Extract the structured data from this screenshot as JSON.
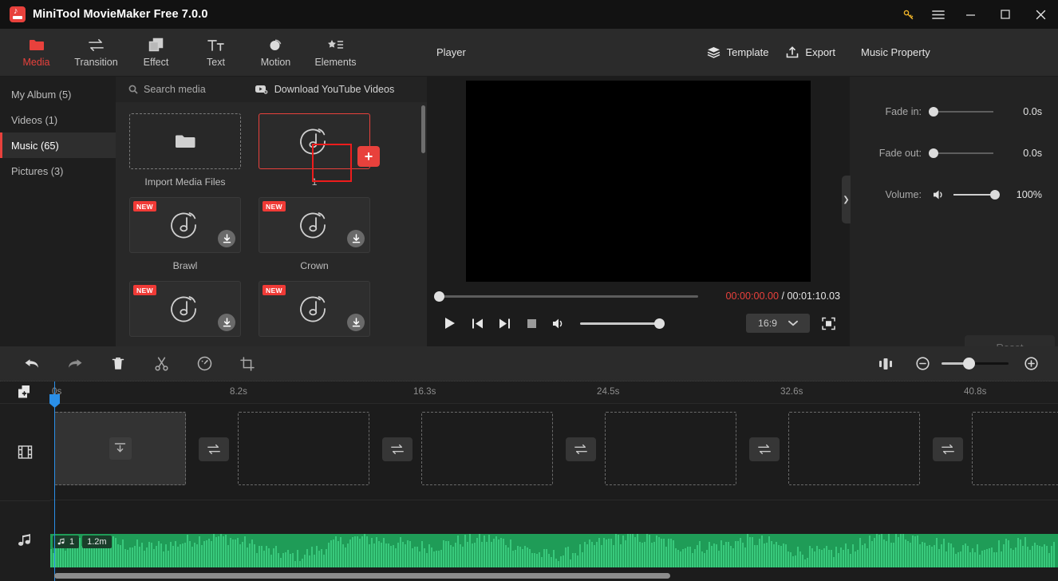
{
  "window": {
    "title": "MiniTool MovieMaker Free 7.0.0",
    "logo_icon": "app-logo-icon",
    "controls": [
      {
        "name": "key-icon",
        "glyph": "key"
      },
      {
        "name": "menu-icon",
        "glyph": "hamburger"
      },
      {
        "name": "minimize-icon",
        "glyph": "minimize"
      },
      {
        "name": "maximize-icon",
        "glyph": "maximize"
      },
      {
        "name": "close-icon",
        "glyph": "close"
      }
    ]
  },
  "nav_tabs": [
    {
      "label": "Media",
      "icon": "folder-icon",
      "active": true
    },
    {
      "label": "Transition",
      "icon": "transition-arrows-icon",
      "active": false
    },
    {
      "label": "Effect",
      "icon": "layers-square-icon",
      "active": false
    },
    {
      "label": "Text",
      "icon": "text-tt-icon",
      "active": false
    },
    {
      "label": "Motion",
      "icon": "motion-circle-icon",
      "active": false
    },
    {
      "label": "Elements",
      "icon": "elements-star-icon",
      "active": false
    }
  ],
  "categories": [
    {
      "label": "My Album (5)",
      "active": false
    },
    {
      "label": "Videos (1)",
      "active": false
    },
    {
      "label": "Music (65)",
      "active": true
    },
    {
      "label": "Pictures (3)",
      "active": false
    }
  ],
  "media_toolbar": {
    "search_placeholder": "Search media",
    "search_icon": "search-icon",
    "download_label": "Download YouTube Videos",
    "download_icon": "youtube-download-icon"
  },
  "media_grid": [
    {
      "label": "Import Media Files",
      "type": "import",
      "icon": "folder-open-icon",
      "is_new": false,
      "has_download": false,
      "selected": false
    },
    {
      "label": "1",
      "type": "music",
      "icon": "music-note-circle-icon",
      "is_new": false,
      "has_download": false,
      "selected": true,
      "add_button": "+"
    },
    {
      "label": "Brawl",
      "type": "music",
      "icon": "music-note-circle-icon",
      "is_new": true,
      "new_badge": "NEW",
      "has_download": true,
      "selected": false
    },
    {
      "label": "Crown",
      "type": "music",
      "icon": "music-note-circle-icon",
      "is_new": true,
      "new_badge": "NEW",
      "has_download": true,
      "selected": false
    },
    {
      "label": "",
      "type": "music",
      "icon": "music-note-circle-icon",
      "is_new": true,
      "new_badge": "NEW",
      "has_download": true,
      "selected": false
    },
    {
      "label": "",
      "type": "music",
      "icon": "music-note-circle-icon",
      "is_new": true,
      "new_badge": "NEW",
      "has_download": true,
      "selected": false
    }
  ],
  "player": {
    "title": "Player",
    "template_label": "Template",
    "template_icon": "layers-icon",
    "export_label": "Export",
    "export_icon": "export-upload-icon",
    "current_time": "00:00:00.00",
    "time_separator": " / ",
    "total_time": "00:01:10.03",
    "progress_percent": 0,
    "volume_percent": 100,
    "aspect_ratio": "16:9",
    "controls": [
      {
        "name": "play-button",
        "icon": "play-icon"
      },
      {
        "name": "previous-frame-button",
        "icon": "skip-back-icon"
      },
      {
        "name": "next-frame-button",
        "icon": "skip-forward-icon"
      },
      {
        "name": "stop-button",
        "icon": "stop-icon"
      },
      {
        "name": "volume-button",
        "icon": "speaker-icon"
      }
    ],
    "fullscreen_icon": "fullscreen-icon",
    "ratio_chevron_icon": "chevron-down-icon"
  },
  "music_property": {
    "title": "Music Property",
    "rows": [
      {
        "label": "Fade in:",
        "value": "0.0s",
        "position": 0
      },
      {
        "label": "Fade out:",
        "value": "0.0s",
        "position": 0
      },
      {
        "label": "Volume:",
        "value": "100%",
        "position": 100,
        "icon": "speaker-icon"
      }
    ],
    "reset_label": "Reset",
    "collapse_icon": "chevron-right-icon"
  },
  "timeline": {
    "toolbar": [
      {
        "name": "undo-button",
        "icon": "undo-arrow-icon"
      },
      {
        "name": "redo-button",
        "icon": "redo-arrow-icon"
      },
      {
        "name": "delete-button",
        "icon": "trash-icon"
      },
      {
        "name": "split-button",
        "icon": "scissors-icon"
      },
      {
        "name": "speed-button",
        "icon": "speed-gauge-icon"
      },
      {
        "name": "crop-button",
        "icon": "crop-icon"
      }
    ],
    "fit_icon": "fit-timeline-icon",
    "zoom_out_icon": "zoom-out-icon",
    "zoom_in_icon": "zoom-in-icon",
    "zoom_level": 40,
    "ruler_ticks": [
      "0s",
      "8.2s",
      "16.3s",
      "24.5s",
      "32.6s",
      "40.8s"
    ],
    "add_track_icon": "add-media-icon",
    "video_track_icon": "film-strip-icon",
    "audio_track_icon": "music-note-icon",
    "transition_icon": "transition-arrows-icon",
    "video_clip_icon": "download-box-icon",
    "audio_clip": {
      "track_number": "1",
      "duration": "1.2m",
      "note_icon": "music-note-icon",
      "color": "#1f9c57"
    }
  },
  "colors": {
    "accent_red": "#e8413c",
    "annotation_red": "#ee1c1c",
    "audio_green": "#1f9c57",
    "playhead_blue": "#2a8fe8",
    "key_yellow": "#f0b429"
  }
}
